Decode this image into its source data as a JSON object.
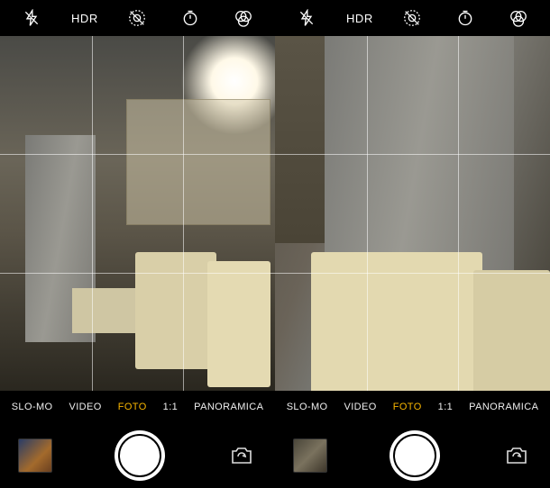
{
  "screens": [
    {
      "top": {
        "flash": "auto-off",
        "hdr": "HDR",
        "livephoto": "off",
        "timer": "off",
        "filters": "none"
      },
      "modes": {
        "items": [
          "SLO-MO",
          "VIDEO",
          "FOTO",
          "1:1",
          "PANORAMICA"
        ],
        "active_index": 2
      },
      "icons": {
        "flash": "flash-auto-off-icon",
        "livephoto": "live-photo-off-icon",
        "timer": "timer-icon",
        "filters": "filters-icon",
        "switch": "switch-camera-icon"
      }
    },
    {
      "top": {
        "flash": "auto-off",
        "hdr": "HDR",
        "livephoto": "off",
        "timer": "off",
        "filters": "none"
      },
      "modes": {
        "items": [
          "SLO-MO",
          "VIDEO",
          "FOTO",
          "1:1",
          "PANORAMICA"
        ],
        "active_index": 2
      },
      "icons": {
        "flash": "flash-auto-off-icon",
        "livephoto": "live-photo-off-icon",
        "timer": "timer-icon",
        "filters": "filters-icon",
        "switch": "switch-camera-icon"
      }
    }
  ],
  "colors": {
    "active_mode": "#f7b500",
    "background": "#000000",
    "grid": "rgba(255,255,255,0.55)"
  }
}
